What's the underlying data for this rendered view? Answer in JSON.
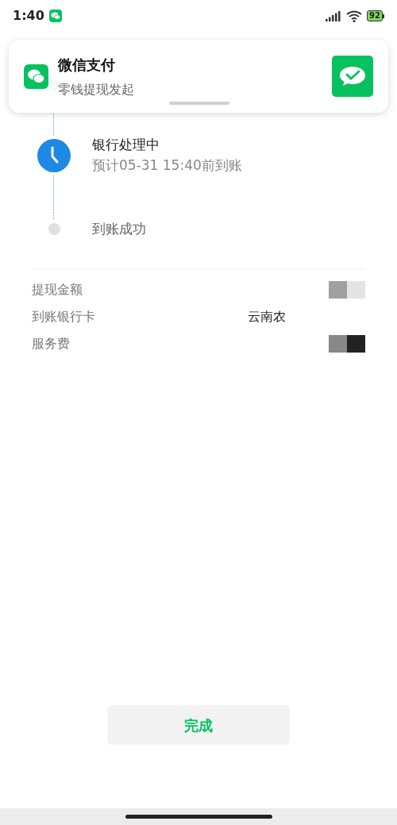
{
  "status_bar": {
    "time": "1:40",
    "battery": "92"
  },
  "notification": {
    "app": "微信支付",
    "message": "零钱提现发起"
  },
  "steps": [
    {
      "kind": "done"
    },
    {
      "kind": "current",
      "title": "银行处理中",
      "subtitle": "预计05-31 15:40前到账"
    },
    {
      "kind": "pending",
      "title": "到账成功"
    }
  ],
  "details": [
    {
      "label": "提现金额",
      "kind": "redacted"
    },
    {
      "label": "到账银行卡",
      "kind": "text",
      "value": "云南农"
    },
    {
      "label": "服务费",
      "kind": "redacted"
    }
  ],
  "button": {
    "label": "完成"
  }
}
